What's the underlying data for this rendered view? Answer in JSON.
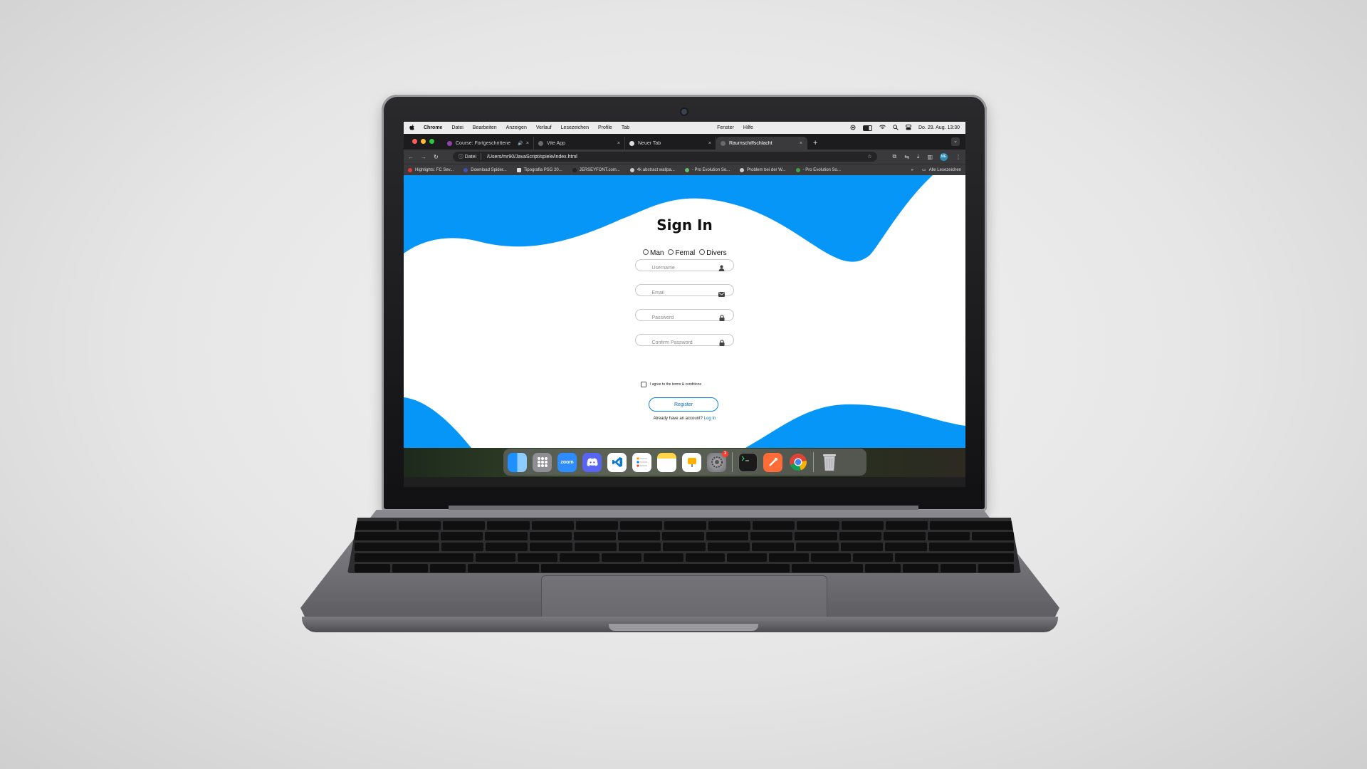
{
  "menubar": {
    "apple": "",
    "app_name": "Chrome",
    "menus": [
      "Datei",
      "Bearbeiten",
      "Anzeigen",
      "Verlauf",
      "Lesezeichen",
      "Profile",
      "Tab"
    ],
    "menus_right": [
      "Fenster",
      "Hilfe"
    ],
    "datetime": "Do. 29. Aug. 13:30"
  },
  "browser": {
    "tabs": [
      {
        "label": "Course: Fortgeschrittene",
        "close": "×"
      },
      {
        "label": "Vite App",
        "close": "×"
      },
      {
        "label": "Neuer Tab",
        "close": "×"
      },
      {
        "label": "Raumschiffschlacht",
        "close": "×"
      }
    ],
    "new_tab": "+",
    "tab_menu": "⌄",
    "address": {
      "chip": "Datei",
      "url": "/Users/mr90/JavaScript/spiele/index.html"
    },
    "profile_initials": "ME",
    "bookmarks": [
      "Highlights: FC Sev...",
      "Download Spider...",
      "Tipografia PSG 20...",
      "JERSEYFONT.com...",
      "4k abstract wallpa...",
      "- Pro Evolution So...",
      "Problem bei der W...",
      "- Pro Evolution So..."
    ],
    "bookmarks_more": "»",
    "all_bookmarks": "Alle Lesezeichen"
  },
  "page": {
    "title": "Sign In",
    "gender_options": [
      "Man",
      "Femal",
      "Divers"
    ],
    "fields": {
      "username_placeholder": "Username",
      "email_placeholder": "Email",
      "password_placeholder": "Password",
      "confirm_placeholder": "Confirm Password"
    },
    "agree_label": "I agree to the terms & conditions",
    "register_label": "Register",
    "account_text": "Already have an account?",
    "login_link": "Log In"
  },
  "dock": {
    "zoom_label": "zoom",
    "notification_badge": "1"
  },
  "colors": {
    "wave": "#0596f8",
    "link": "#0a6fbd"
  }
}
